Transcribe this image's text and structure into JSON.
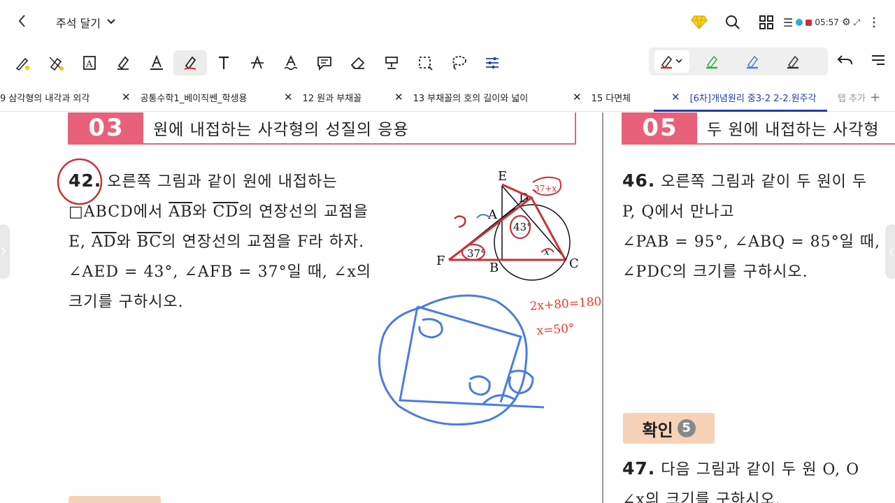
{
  "topbar": {
    "back_icon": "chevron-left-icon",
    "menu_label": "주석 달기",
    "status_time": "05:57"
  },
  "toolbar": {
    "tools": [
      "pen-lasso-icon",
      "eraser-pen-icon",
      "text-box-icon",
      "highlighter-icon",
      "text-color-icon",
      "pen-icon",
      "text-icon",
      "strikethrough-icon",
      "wave-underline-icon",
      "comment-icon",
      "eraser-icon",
      "stamp-icon",
      "select-icon",
      "lasso-icon",
      "settings-sliders-icon"
    ],
    "active_tool": "pen-icon",
    "pen_colors": [
      "#d62b2b",
      "#2fa84f",
      "#4a7de0",
      "#333333"
    ]
  },
  "tabs": {
    "items": [
      {
        "label": "9 삼각형의 내각과 외각"
      },
      {
        "label": "공통수학1_베이직쎈_학생용"
      },
      {
        "label": "12 원과 부채꼴"
      },
      {
        "label": "13 부채꼴의 호의 길이와 넓이"
      },
      {
        "label": "15 다면체"
      },
      {
        "label": "[6차]개념원리 중3-2 2-2.원주각"
      }
    ],
    "add_label": "탭 추가"
  },
  "left_page": {
    "section_num": "03",
    "section_title": "원에 내접하는 사각형의 성질의 응용",
    "q42": {
      "num": "42.",
      "line1": "오른쪽 그림과 같이 원에 내접하는",
      "line2_a": "□ABCD에서 ",
      "ab": "AB",
      "line2_b": "와 ",
      "cd": "CD",
      "line2_c": "의 연장선의 교점을",
      "line3_a": "E, ",
      "ad": "AD",
      "line3_b": "와 ",
      "bc": "BC",
      "line3_c": "의 연장선의 교점을 F라 하자.",
      "line4": "∠AED = 43°, ∠AFB = 37°일 때, ∠x의",
      "line5": "크기를 구하시오."
    },
    "figure": {
      "labels": {
        "E": "E",
        "D": "D",
        "A": "A",
        "F": "F",
        "B": "B",
        "C": "C"
      },
      "angle_43": "43°",
      "angle_37": "37°",
      "angle_x": "x"
    },
    "handwriting": {
      "eq1": "2x+80=180",
      "eq2": "x=50°"
    }
  },
  "right_page": {
    "section_num": "05",
    "section_title": "두 원에 내접하는 사각형",
    "q46": {
      "num": "46.",
      "line1": "오른쪽 그림과 같이 두 원이 두",
      "line2": "P, Q에서 만나고",
      "line3": "∠PAB = 95°, ∠ABQ = 85°일 때,",
      "line4": "∠PDC의 크기를 구하시오."
    },
    "check_label": "확인",
    "check_num": "5",
    "q47": {
      "num": "47.",
      "line1": "다음 그림과 같이 두 원 O, O",
      "line2": "∠x의 크기를 구하시오."
    }
  }
}
